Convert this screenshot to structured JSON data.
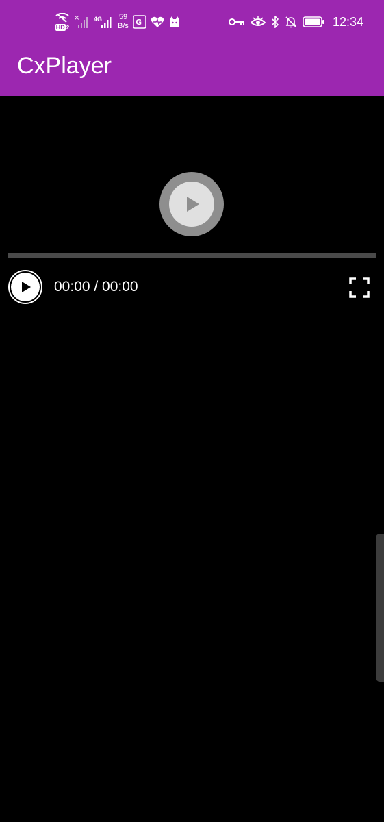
{
  "status_bar": {
    "hd_label": "HD",
    "hd_sim": "2",
    "network_type": "4G",
    "net_speed_value": "59",
    "net_speed_unit": "B/s",
    "time": "12:34",
    "icons": [
      "wifi-off-icon",
      "sim-no-signal-icon",
      "signal-4g-icon",
      "translate-icon",
      "health-heart-icon",
      "cat-app-icon",
      "vpn-key-icon",
      "eye-comfort-icon",
      "bluetooth-icon",
      "notifications-off-icon",
      "battery-icon"
    ]
  },
  "app_bar": {
    "title": "CxPlayer",
    "color": "#9C27B0"
  },
  "player": {
    "time_display": "00:00 / 00:00",
    "progress": 0,
    "icons": [
      "play-icon",
      "fullscreen-icon"
    ]
  }
}
